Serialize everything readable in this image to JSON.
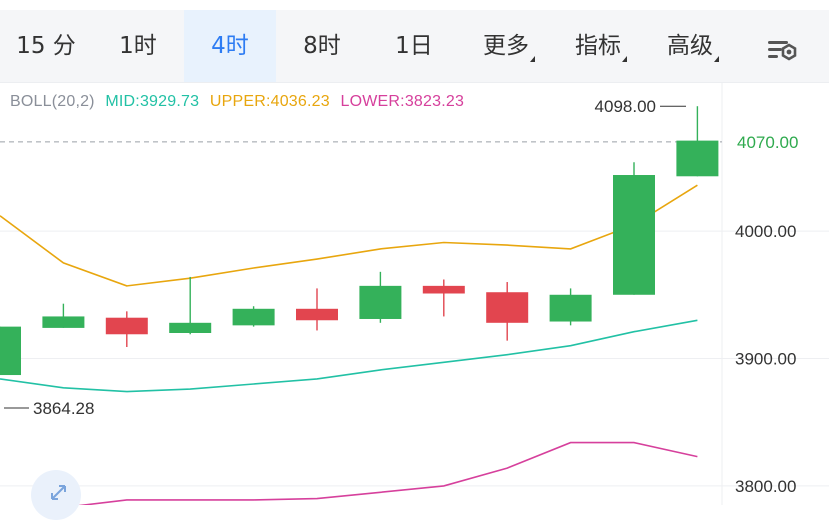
{
  "toolbar": {
    "tabs": [
      {
        "label": "15 分",
        "active": false
      },
      {
        "label": "1时",
        "active": false
      },
      {
        "label": "4时",
        "active": true
      },
      {
        "label": "8时",
        "active": false
      },
      {
        "label": "1日",
        "active": false
      },
      {
        "label": "更多",
        "active": false,
        "dropdown": true
      },
      {
        "label": "指标",
        "active": false,
        "dropdown": true
      },
      {
        "label": "高级",
        "active": false,
        "dropdown": true
      }
    ],
    "settings_icon": "chart-settings-icon",
    "colors": {
      "active_text": "#2d7cf3",
      "active_bg": "#e8f2fd",
      "text": "#333333"
    }
  },
  "indicator": {
    "name": "BOLL(20,2)",
    "mid_label": "MID:3929.73",
    "upper_label": "UPPER:4036.23",
    "lower_label": "LOWER:3823.23"
  },
  "chart_data": {
    "type": "candlestick",
    "ylim": [
      3785,
      4117
    ],
    "yticks": [
      {
        "value": 4000,
        "label": "4000.00"
      },
      {
        "value": 3900,
        "label": "3900.00"
      },
      {
        "value": 3800,
        "label": "3800.00"
      }
    ],
    "current_price": {
      "value": 4070,
      "label": "4070.00"
    },
    "high_label": {
      "value": 4098,
      "label": "4098.00"
    },
    "low_label": {
      "value": 3864.28,
      "label": "3864.28"
    },
    "candles": [
      {
        "open": 3887,
        "close": 3925,
        "high": 3925,
        "low": 3887,
        "up": true
      },
      {
        "open": 3924,
        "close": 3933,
        "high": 3943,
        "low": 3924,
        "up": true
      },
      {
        "open": 3932,
        "close": 3919,
        "high": 3937,
        "low": 3909,
        "up": false
      },
      {
        "open": 3920,
        "close": 3928,
        "high": 3964,
        "low": 3919,
        "up": true
      },
      {
        "open": 3926,
        "close": 3939,
        "high": 3941,
        "low": 3925,
        "up": true
      },
      {
        "open": 3939,
        "close": 3930,
        "high": 3955,
        "low": 3922,
        "up": false
      },
      {
        "open": 3931,
        "close": 3957,
        "high": 3968,
        "low": 3928,
        "up": true
      },
      {
        "open": 3957,
        "close": 3951,
        "high": 3962,
        "low": 3933,
        "up": false
      },
      {
        "open": 3952,
        "close": 3928,
        "high": 3960,
        "low": 3914,
        "up": false
      },
      {
        "open": 3929,
        "close": 3950,
        "high": 3955,
        "low": 3926,
        "up": true
      },
      {
        "open": 3950,
        "close": 4044,
        "high": 4054,
        "low": 3950,
        "up": true
      },
      {
        "open": 4043,
        "close": 4071,
        "high": 4098,
        "low": 4043,
        "up": true
      }
    ],
    "upper_band": [
      4012,
      3975,
      3957,
      3963,
      3971,
      3978,
      3986,
      3991,
      3989,
      3986,
      4005,
      4036
    ],
    "mid_band": [
      3884,
      3877,
      3874,
      3876,
      3880,
      3884,
      3891,
      3897,
      3903,
      3910,
      3921,
      3930
    ],
    "lower_band": [
      3777,
      3783,
      3789,
      3789,
      3789,
      3790,
      3795,
      3800,
      3814,
      3834,
      3834,
      3823
    ],
    "colors": {
      "up": "#34b15a",
      "down": "#e2454f",
      "upper": "#e8a60e",
      "mid": "#22c1a5",
      "lower": "#d6409c",
      "grid": "#eeeff2",
      "axis_text": "#333333",
      "current_price": "#2faa4e"
    }
  },
  "expand_icon": "expand-arrows-icon"
}
